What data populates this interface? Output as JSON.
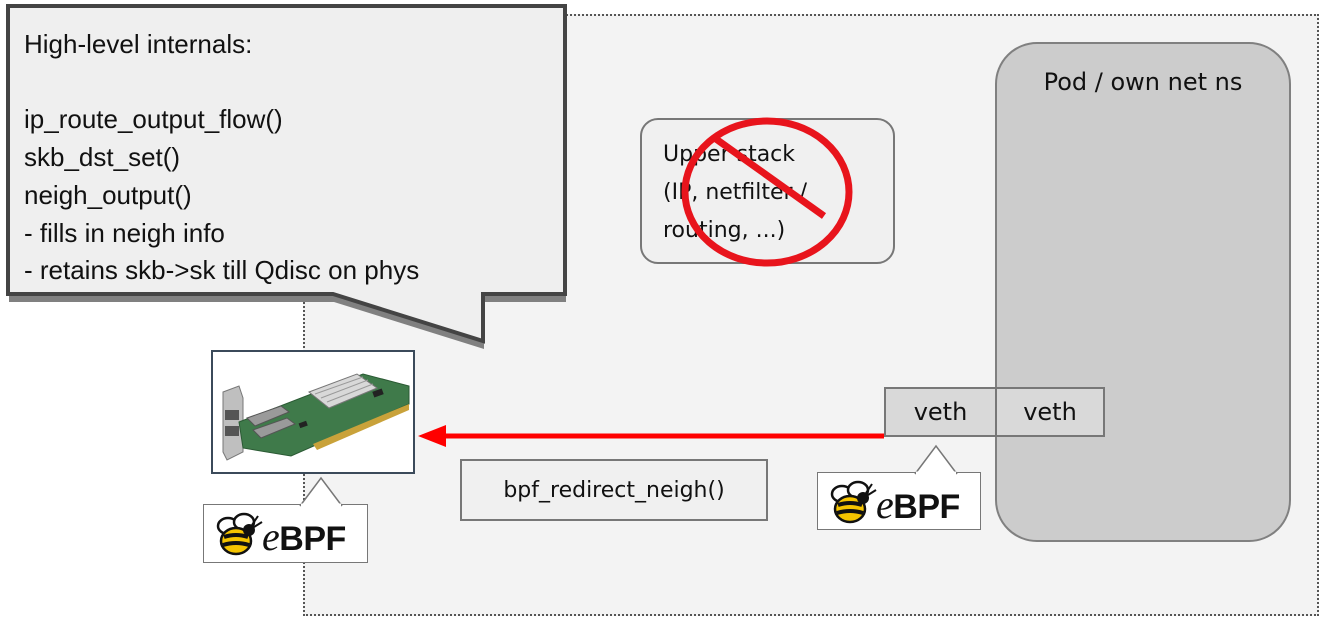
{
  "callout": {
    "lines": [
      "High-level internals:",
      "",
      "ip_route_output_flow()",
      "skb_dst_set()",
      "neigh_output()",
      "- fills in neigh info",
      "- retains skb->sk till Qdisc on phys"
    ]
  },
  "pod": {
    "label": "Pod / own net ns"
  },
  "upper_stack": {
    "lines": [
      "Upper stack",
      "(IP, netfilter /",
      "routing, ...)"
    ],
    "crossed_out": true
  },
  "veth": {
    "host_label": "veth",
    "pod_label": "veth"
  },
  "redirect": {
    "label": "bpf_redirect_neigh()"
  },
  "ebpf_badges": [
    {
      "prefix": "e",
      "suffix": "BPF"
    },
    {
      "prefix": "e",
      "suffix": "BPF"
    }
  ],
  "nic": {
    "icon": "network-card-icon"
  },
  "colors": {
    "arrow": "#ff0000",
    "prohibition": "#e8141c",
    "host_ns_background": "#f3f3f3",
    "pod_background": "#cccccc"
  }
}
